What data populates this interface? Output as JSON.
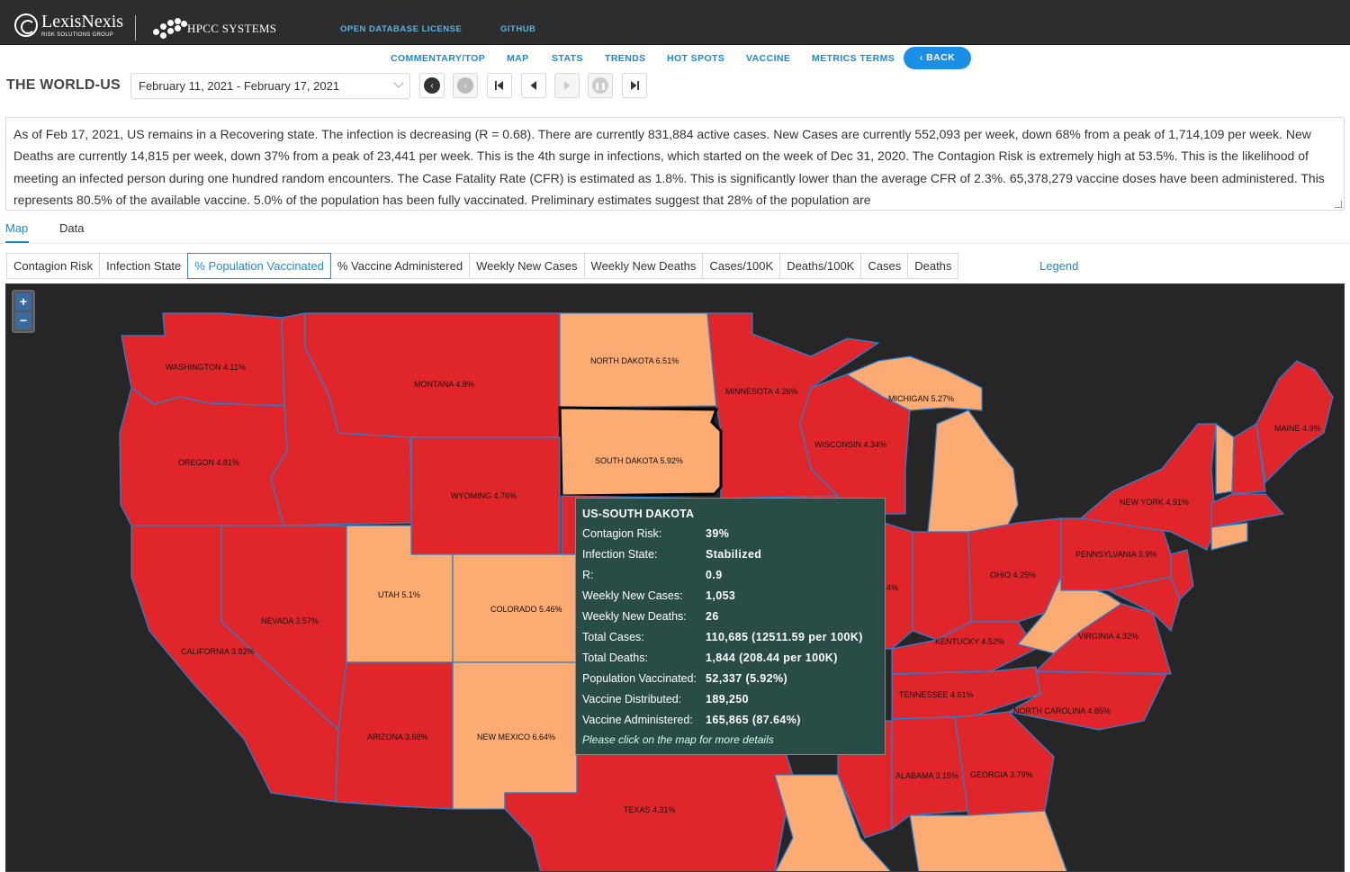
{
  "header": {
    "brand1": "LexisNexis",
    "brand1_sub": "RISK SOLUTIONS GROUP",
    "brand2": "HPCC SYSTEMS",
    "links": [
      "OPEN DATABASE LICENSE",
      "GITHUB"
    ]
  },
  "nav": {
    "items": [
      "COMMENTARY/TOP",
      "MAP",
      "STATS",
      "TRENDS",
      "HOT SPOTS",
      "VACCINE",
      "METRICS TERMS"
    ],
    "back": "BACK"
  },
  "page": {
    "title": "THE WORLD-US",
    "date_range": "February 11, 2021 - February 17, 2021"
  },
  "commentary": "As of Feb 17, 2021, US remains in a Recovering state. The infection is decreasing (R = 0.68). There are currently 831,884 active cases. New Cases are currently 552,093 per week, down 68% from a peak of 1,714,109 per week. New Deaths are currently 14,815 per week, down 37% from a peak of 23,441 per week. This is the 4th surge in infections, which started on the week of Dec 31, 2020. The Contagion Risk is extremely high  at 53.5%. This is the likelihood of meeting an infected person during one hundred random encounters. The Case Fatality Rate (CFR) is estimated as 1.8%. This is significantly lower than the average CFR of 2.3%. 65,378,279 vaccine doses have been administered. This represents 80.5% of the available vaccine. 5.0% of the population has been fully vaccinated. Preliminary estimates suggest that 28% of the population are",
  "tabs": [
    "Map",
    "Data"
  ],
  "layers": [
    "Contagion Risk",
    "Infection State",
    "% Population Vaccinated",
    "% Vaccine Administered",
    "Weekly New Cases",
    "Weekly New Deaths",
    "Cases/100K",
    "Deaths/100K",
    "Cases",
    "Deaths"
  ],
  "legend_link": "Legend",
  "zoom": {
    "in": "+",
    "out": "−"
  },
  "colors": {
    "high": "#e0262b",
    "low": "#fcab72",
    "tooltip_bg": "#294c47",
    "accent": "#1a8fe6"
  },
  "map_labels": {
    "wa": "WASHINGTON 4.11%",
    "mt": "MONTANA 4.8%",
    "nd": "NORTH DAKOTA 6.51%",
    "mn": "MINNESOTA 4.26%",
    "mi": "MICHIGAN 5.27%",
    "or": "OREGON 4.81%",
    "sd": "SOUTH DAKOTA 5.92%",
    "wi": "WISCONSIN 4.34%",
    "me": "MAINE 4.9%",
    "wy": "WYOMING 4.76%",
    "ny": "NEW YORK 4.91%",
    "pa": "PENNSYLVANIA 3.9%",
    "ut": "UTAH 5.1%",
    "co": "COLORADO 5.46%",
    "oh": "OHIO 4.25%",
    "nv": "NEVADA 3.57%",
    "ca": "CALIFORNIA 3.82%",
    "va": "VIRGINIA 4.32%",
    "ky": "KENTUCKY 4.52%",
    "tn": "TENNESSEE 4.61%",
    "nc": "NORTH CAROLINA 4.85%",
    "az": "ARIZONA 3.68%",
    "nm": "NEW MEXICO 6.64%",
    "al": "ALABAMA 3.15%",
    "ga": "GEORGIA 3.79%",
    "tx": "TEXAS 4.31%",
    "frag": "4%"
  },
  "tooltip": {
    "title": "US-SOUTH DAKOTA",
    "rows": [
      {
        "k": "Contagion Risk:",
        "v": "39%"
      },
      {
        "k": "Infection State:",
        "v": "Stabilized"
      },
      {
        "k": "R:",
        "v": "0.9"
      },
      {
        "k": "Weekly New Cases:",
        "v": "1,053"
      },
      {
        "k": "Weekly New Deaths:",
        "v": "26"
      },
      {
        "k": "Total Cases:",
        "v": "110,685 (12511.59 per 100K)"
      },
      {
        "k": "Total Deaths:",
        "v": "1,844 (208.44 per 100K)"
      },
      {
        "k": "Population Vaccinated:",
        "v": "52,337 (5.92%)"
      },
      {
        "k": "Vaccine Distributed:",
        "v": "189,250"
      },
      {
        "k": "Vaccine Administered:",
        "v": "165,865 (87.64%)"
      }
    ],
    "note": "Please click on the map for more details"
  }
}
